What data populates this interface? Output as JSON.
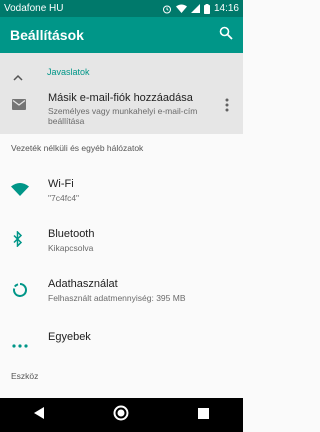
{
  "status_bar": {
    "carrier": "Vodafone HU",
    "time": "14:16"
  },
  "app_bar": {
    "title": "Beállítások"
  },
  "suggestions": {
    "header": "Javaslatok",
    "item": {
      "title": "Másik e-mail-fiók hozzáadása",
      "subtitle_line1": "Személyes vagy munkahelyi e-mail-cím",
      "subtitle_line2": "beállítása"
    }
  },
  "sections": {
    "network": {
      "header": "Vezeték nélküli és egyéb hálózatok",
      "items": [
        {
          "title": "Wi-Fi",
          "subtitle": "\"7c4fc4\""
        },
        {
          "title": "Bluetooth",
          "subtitle": "Kikapcsolva"
        },
        {
          "title": "Adathasználat",
          "subtitle": "Felhasznált adatmennyiség: 395 MB"
        },
        {
          "title": "Egyebek"
        }
      ]
    },
    "device": {
      "header": "Eszköz"
    }
  },
  "colors": {
    "accent": "#009688",
    "status_bar": "#00796b"
  }
}
